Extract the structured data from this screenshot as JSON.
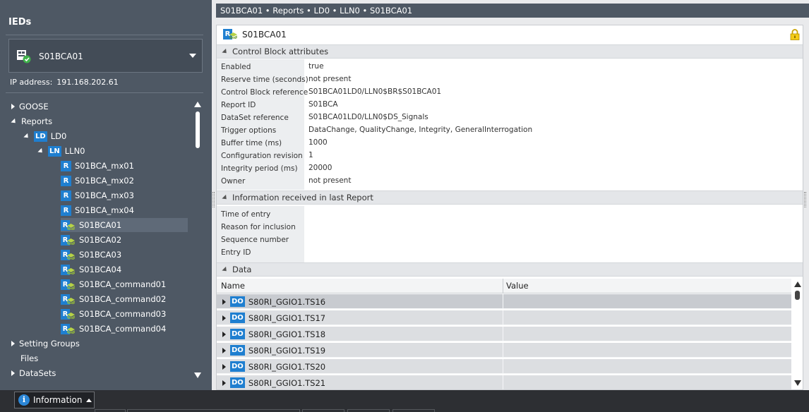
{
  "left_panel": {
    "title": "IEDs",
    "device": {
      "name": "S01BCA01"
    },
    "ip_label": "IP address:",
    "ip_value": "191.168.202.61",
    "tree": {
      "goose": "GOOSE",
      "reports": "Reports",
      "ld": {
        "badge": "LD",
        "label": "LD0"
      },
      "ln": {
        "badge": "LN",
        "label": "LLN0"
      },
      "report_items": [
        {
          "label": "S01BCA_mx01",
          "kind": "R"
        },
        {
          "label": "S01BCA_mx02",
          "kind": "R"
        },
        {
          "label": "S01BCA_mx03",
          "kind": "R"
        },
        {
          "label": "S01BCA_mx04",
          "kind": "R"
        },
        {
          "label": "S01BCA01",
          "kind": "RS",
          "selected": true
        },
        {
          "label": "S01BCA02",
          "kind": "RS"
        },
        {
          "label": "S01BCA03",
          "kind": "RS"
        },
        {
          "label": "S01BCA04",
          "kind": "RS"
        },
        {
          "label": "S01BCA_command01",
          "kind": "RS"
        },
        {
          "label": "S01BCA_command02",
          "kind": "RS"
        },
        {
          "label": "S01BCA_command03",
          "kind": "RS"
        },
        {
          "label": "S01BCA_command04",
          "kind": "RS"
        }
      ],
      "setting_groups": "Setting Groups",
      "files": "Files",
      "datasets": "DataSets"
    }
  },
  "breadcrumb": "S01BCA01 • Reports • LD0 • LLN0 • S01BCA01",
  "object": {
    "name": "S01BCA01",
    "icon": "report-stack-icon",
    "lock_icon": "lock-icon"
  },
  "control_block": {
    "title": "Control Block attributes",
    "rows": [
      {
        "label": "Enabled",
        "value": "true"
      },
      {
        "label": "Reserve time (seconds)",
        "value": "not present"
      },
      {
        "label": "Control Block reference",
        "value": "S01BCA01LD0/LLN0$BR$S01BCA01"
      },
      {
        "label": "Report ID",
        "value": "S01BCA"
      },
      {
        "label": "DataSet reference",
        "value": "S01BCA01LD0/LLN0$DS_Signals"
      },
      {
        "label": "Trigger options",
        "value": "DataChange, QualityChange, Integrity, GeneralInterrogation"
      },
      {
        "label": "Buffer time (ms)",
        "value": "1000"
      },
      {
        "label": "Configuration revision",
        "value": "1"
      },
      {
        "label": "Integrity period (ms)",
        "value": "20000"
      },
      {
        "label": "Owner",
        "value": "not present"
      }
    ]
  },
  "last_report": {
    "title": "Information received in last Report",
    "rows": [
      {
        "label": "Time of entry",
        "value": ""
      },
      {
        "label": "Reason for inclusion",
        "value": ""
      },
      {
        "label": "Sequence number",
        "value": ""
      },
      {
        "label": "Entry ID",
        "value": ""
      }
    ]
  },
  "data_section": {
    "title": "Data",
    "columns": [
      "Name",
      "Value"
    ],
    "rows": [
      {
        "badge": "DO",
        "name": "S80RI_GGIO1.TS16",
        "value": ""
      },
      {
        "badge": "DO",
        "name": "S80RI_GGIO1.TS17",
        "value": ""
      },
      {
        "badge": "DO",
        "name": "S80RI_GGIO1.TS18",
        "value": ""
      },
      {
        "badge": "DO",
        "name": "S80RI_GGIO1.TS19",
        "value": ""
      },
      {
        "badge": "DO",
        "name": "S80RI_GGIO1.TS20",
        "value": ""
      },
      {
        "badge": "DO",
        "name": "S80RI_GGIO1.TS21",
        "value": ""
      }
    ]
  },
  "statusbar": {
    "info_label": "Information",
    "info_icon": "i"
  },
  "colors": {
    "panel": "#4e5864",
    "accent": "#1f7fd0",
    "statusbar": "#2d2f33"
  }
}
